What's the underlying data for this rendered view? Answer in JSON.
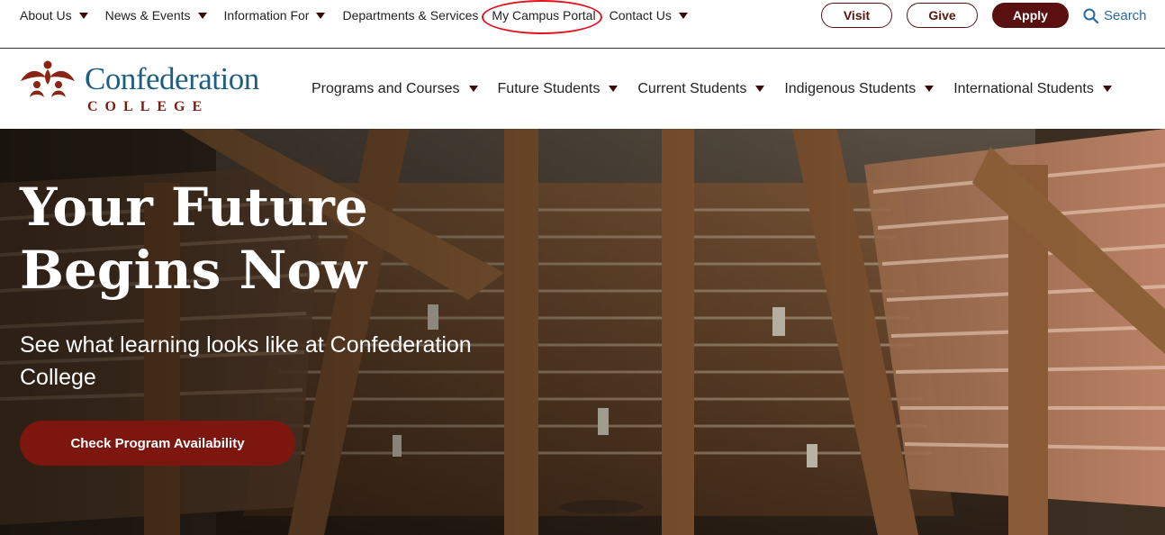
{
  "utility": {
    "links": [
      {
        "label": "About Us"
      },
      {
        "label": "News & Events"
      },
      {
        "label": "Information For"
      },
      {
        "label": "Departments & Services"
      },
      {
        "label": "My Campus Portal"
      },
      {
        "label": "Contact Us"
      }
    ],
    "visit_label": "Visit",
    "give_label": "Give",
    "apply_label": "Apply",
    "search_label": "Search"
  },
  "logo": {
    "name": "Confederation",
    "sub": "COLLEGE"
  },
  "nav": {
    "items": [
      {
        "label": "Programs and Courses"
      },
      {
        "label": "Future Students"
      },
      {
        "label": "Current Students"
      },
      {
        "label": "Indigenous Students"
      },
      {
        "label": "International Students"
      }
    ]
  },
  "hero": {
    "title_line1": "Your Future",
    "title_line2": "Begins Now",
    "subtitle": "See what learning looks like at Confederation College",
    "cta_label": "Check Program Availability"
  },
  "colors": {
    "brand_maroon": "#5a1010",
    "brand_blue": "#1e5e83",
    "cta_red": "#7d160e",
    "annotation_red": "#e2121e",
    "search_blue": "#2a6aa0"
  },
  "icons": {
    "search": "magnifier-icon",
    "caret": "caret-down-icon",
    "logo": "bird-emblem-icon"
  }
}
